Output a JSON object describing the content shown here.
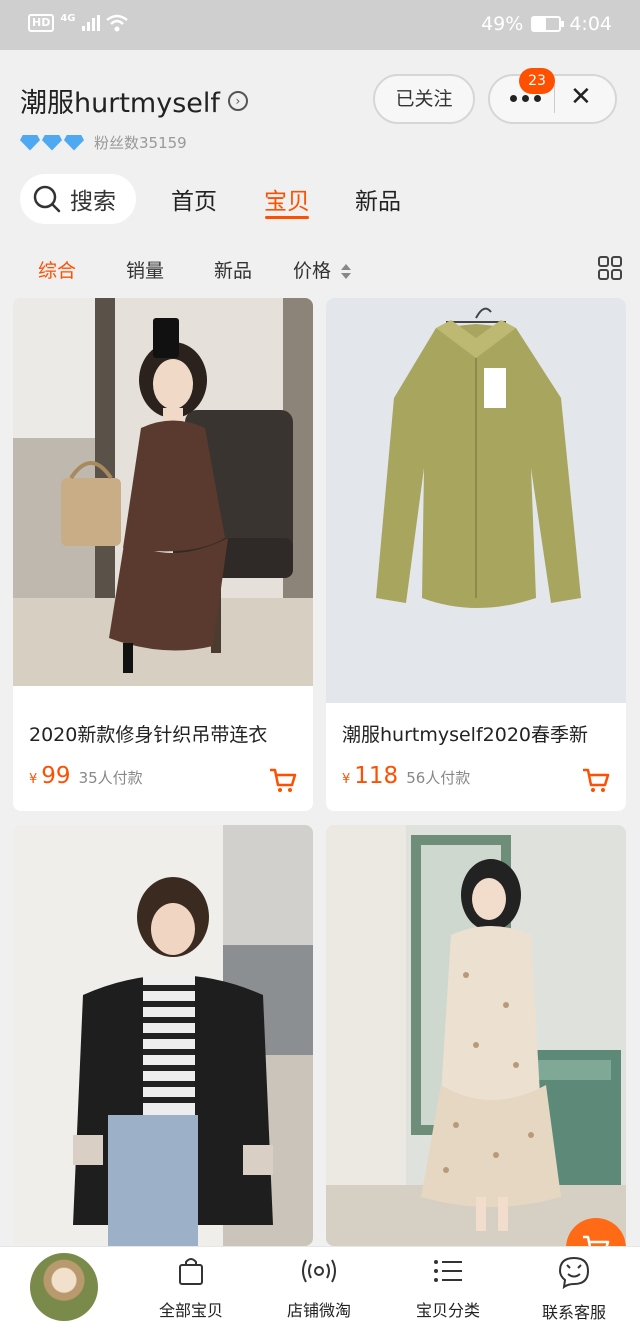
{
  "status_bar": {
    "network": "4G",
    "hd": "HD",
    "battery": "49%",
    "time": "4:04",
    "battery_level": 0.49
  },
  "shop": {
    "name": "潮服hurtmyself",
    "fans_label": "粉丝数35159",
    "follow_label": "已关注",
    "notification_count": "23"
  },
  "nav": {
    "search_label": "搜索",
    "tabs": [
      {
        "label": "首页",
        "active": false
      },
      {
        "label": "宝贝",
        "active": true
      },
      {
        "label": "新品",
        "active": false
      }
    ]
  },
  "sort": {
    "items": [
      {
        "label": "综合",
        "active": true
      },
      {
        "label": "销量",
        "active": false
      },
      {
        "label": "新品",
        "active": false
      },
      {
        "label": "价格",
        "active": false
      }
    ]
  },
  "products": [
    {
      "title": "2020新款修身针织吊带连衣",
      "currency": "¥",
      "price": "99",
      "sold": "35人付款"
    },
    {
      "title": "潮服hurtmyself2020春季新",
      "currency": "¥",
      "price": "118",
      "sold": "56人付款"
    },
    {
      "title": "",
      "currency": "",
      "price": "",
      "sold": ""
    },
    {
      "title": "",
      "currency": "",
      "price": "",
      "sold": ""
    }
  ],
  "bottom_bar": {
    "items": [
      {
        "label": "全部宝贝",
        "icon": "bag-icon"
      },
      {
        "label": "店铺微淘",
        "icon": "broadcast-icon"
      },
      {
        "label": "宝贝分类",
        "icon": "list-icon"
      },
      {
        "label": "联系客服",
        "icon": "chat-face-icon"
      }
    ]
  },
  "colors": {
    "accent": "#ff5000",
    "background": "#f0f0f0"
  }
}
